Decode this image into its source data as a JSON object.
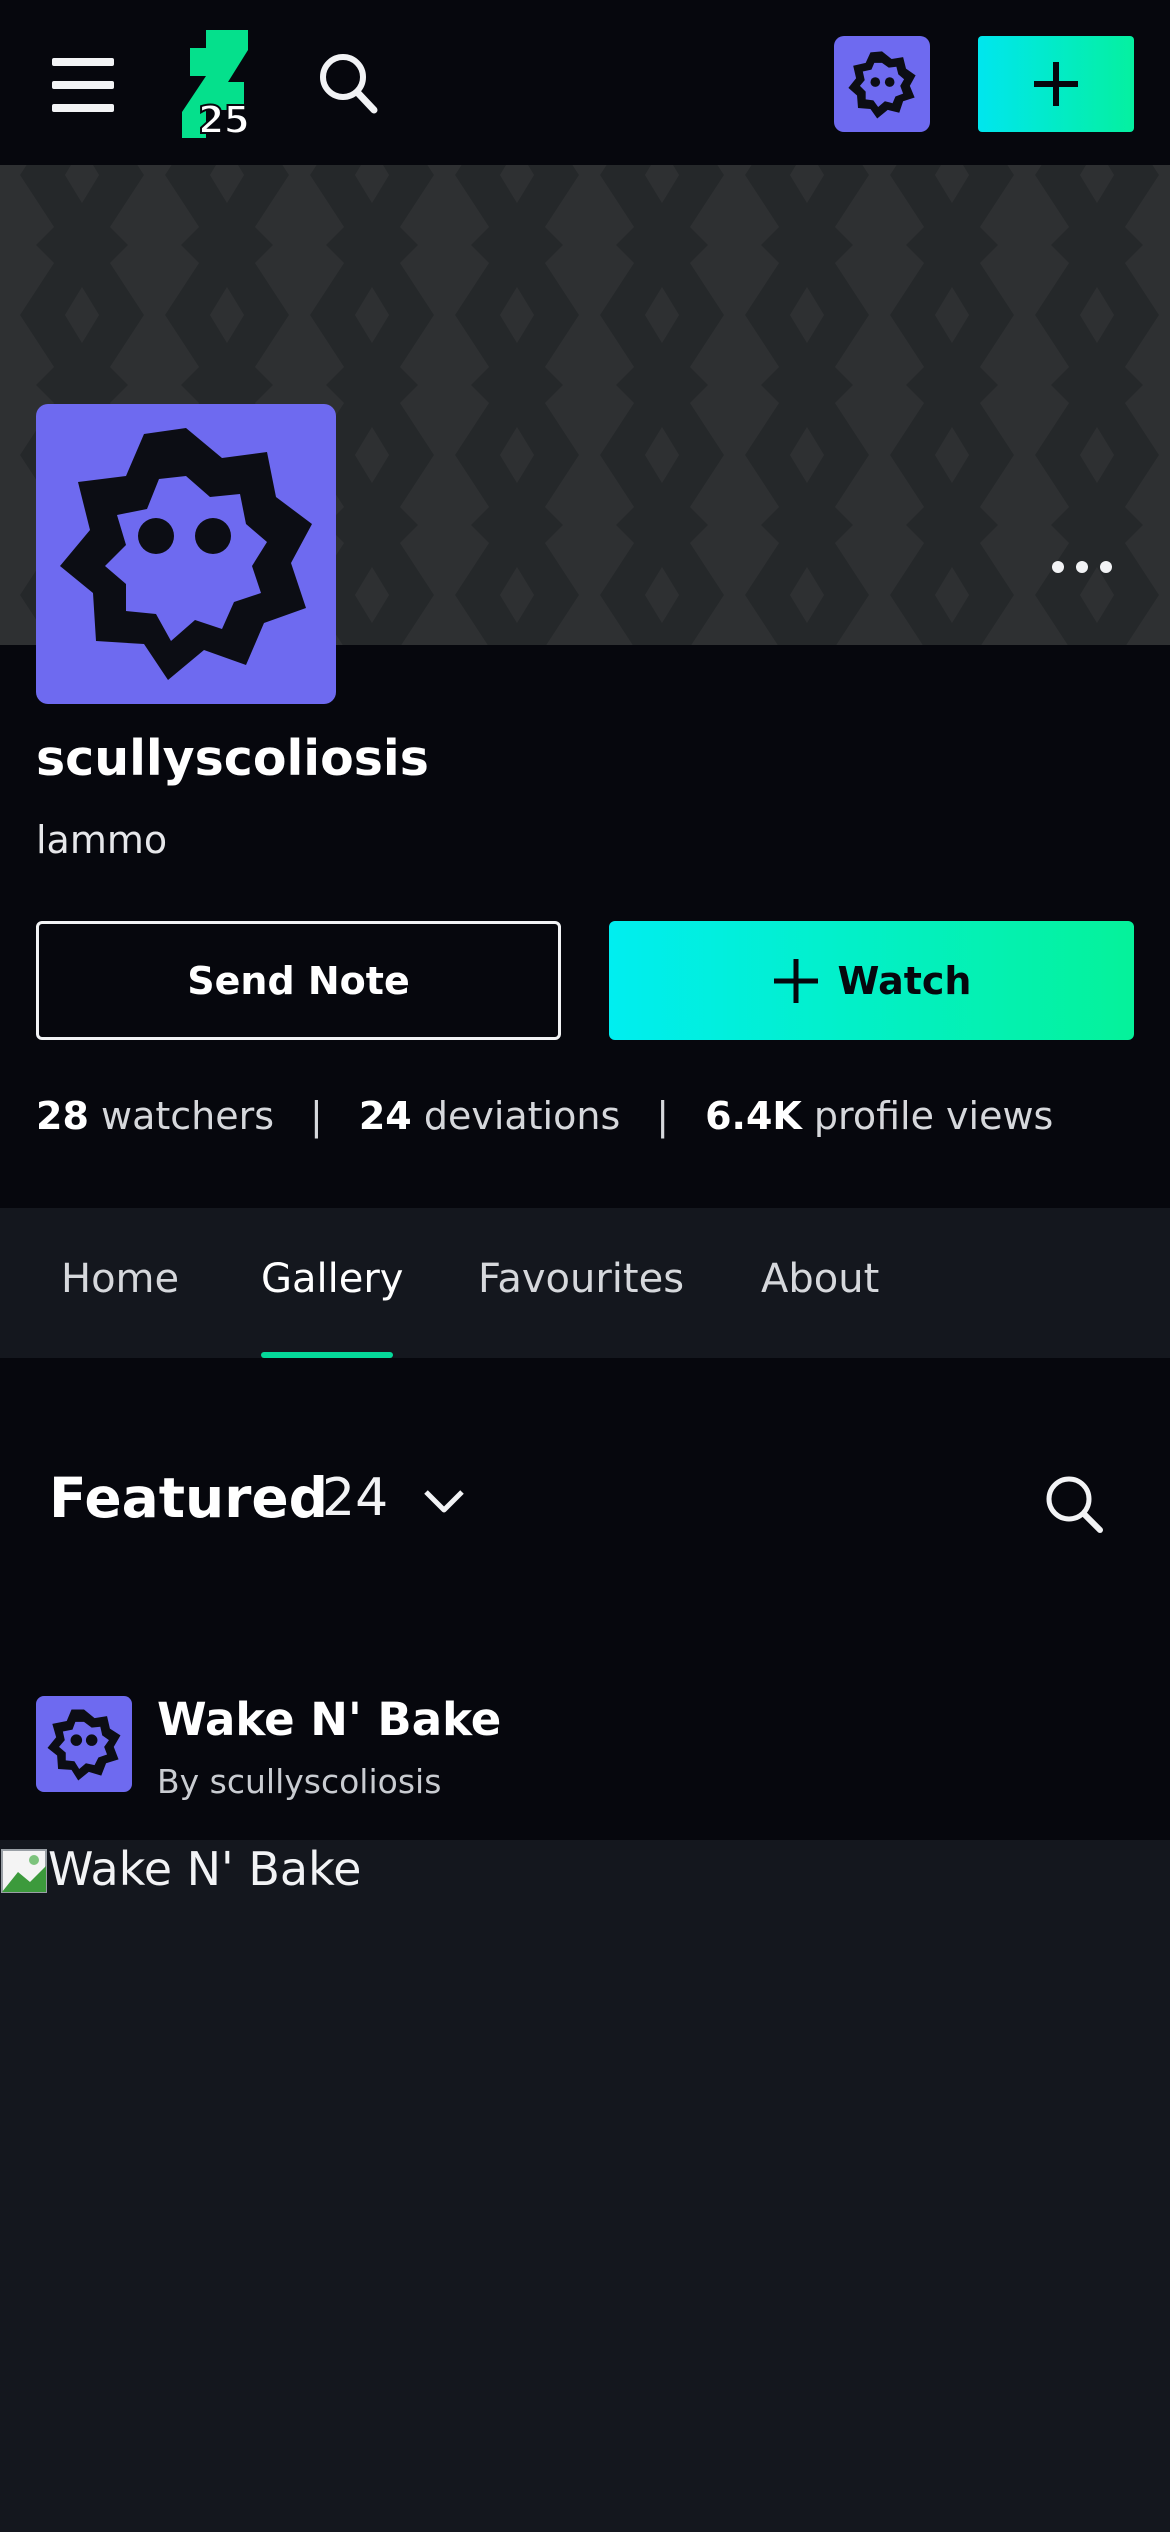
{
  "header": {
    "menu_icon": "hamburger-menu-icon",
    "logo_badge": "25",
    "search_icon": "search-icon",
    "create_icon": "plus-icon",
    "accent_gradient": [
      "#00e6ee",
      "#05f0a0"
    ]
  },
  "profile": {
    "username": "scullyscoliosis",
    "tagline": "lammo",
    "avatar_color": "#6e6af0",
    "more_icon": "more-horizontal-icon"
  },
  "actions": {
    "send_note": "Send Note",
    "watch": "Watch"
  },
  "stats": [
    {
      "value": "28",
      "label": "watchers"
    },
    {
      "value": "24",
      "label": "deviations"
    },
    {
      "value": "6.4K",
      "label": "profile views"
    }
  ],
  "tabs": [
    {
      "label": "Home",
      "active": false
    },
    {
      "label": "Gallery",
      "active": true
    },
    {
      "label": "Favourites",
      "active": false
    },
    {
      "label": "About",
      "active": false
    }
  ],
  "gallery": {
    "section_title": "Featured",
    "count": "24",
    "dropdown_icon": "chevron-down-icon",
    "search_icon": "search-icon"
  },
  "deviation": {
    "title": "Wake N' Bake",
    "author": "By scullyscoliosis",
    "image_alt": "Wake N' Bake"
  }
}
